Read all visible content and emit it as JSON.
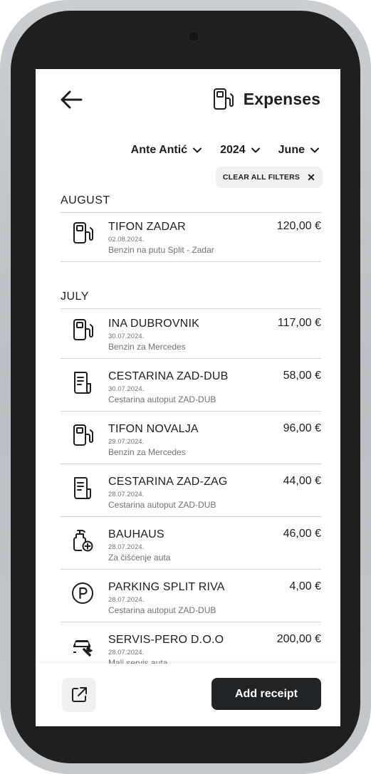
{
  "header": {
    "title": "Expenses"
  },
  "filters": {
    "person": "Ante Antić",
    "year": "2024",
    "month": "June"
  },
  "clear_filters": {
    "label": "CLEAR ALL FILTERS",
    "close_glyph": "✕"
  },
  "groups": [
    {
      "month": "AUGUST",
      "items": [
        {
          "icon": "fuel-pump-icon",
          "name": "TIFON ZADAR",
          "date": "02.08.2024.",
          "note": "Benzin na putu Split - Zadar",
          "amount": "120,00 €"
        }
      ]
    },
    {
      "month": "JULY",
      "items": [
        {
          "icon": "fuel-pump-icon",
          "name": "INA DUBROVNIK",
          "date": "30.07.2024.",
          "note": "Benzin za Mercedes",
          "amount": "117,00 €"
        },
        {
          "icon": "receipt-icon",
          "name": "CESTARINA ZAD-DUB",
          "date": "30.07.2024.",
          "note": "Cestarina autoput ZAD-DUB",
          "amount": "58,00 €"
        },
        {
          "icon": "fuel-pump-icon",
          "name": "TIFON NOVALJA",
          "date": "29.07.2024.",
          "note": "Benzin za Mercedes",
          "amount": "96,00 €"
        },
        {
          "icon": "receipt-icon",
          "name": "CESTARINA ZAD-ZAG",
          "date": "28.07.2024.",
          "note": "Cestarina autoput ZAD-DUB",
          "amount": "44,00 €"
        },
        {
          "icon": "cleaning-bottle-icon",
          "name": "BAUHAUS",
          "date": "28.07.2024.",
          "note": "Za čišćenje auta",
          "amount": "46,00 €"
        },
        {
          "icon": "parking-icon",
          "name": "PARKING SPLIT RIVA",
          "date": "28.07.2024.",
          "note": "Cestarina autoput ZAD-DUB",
          "amount": "4,00 €"
        },
        {
          "icon": "car-service-icon",
          "name": "SERVIS-PERO D.O.O",
          "date": "28.07.2024.",
          "note": "Mali servis auta",
          "amount": "200,00 €"
        }
      ]
    }
  ],
  "bottom": {
    "add_label": "Add receipt"
  },
  "colors": {
    "primary": "#212427",
    "chip_bg": "#eef0f1",
    "divider": "#cfd3d6",
    "muted_text": "#6e7479"
  }
}
